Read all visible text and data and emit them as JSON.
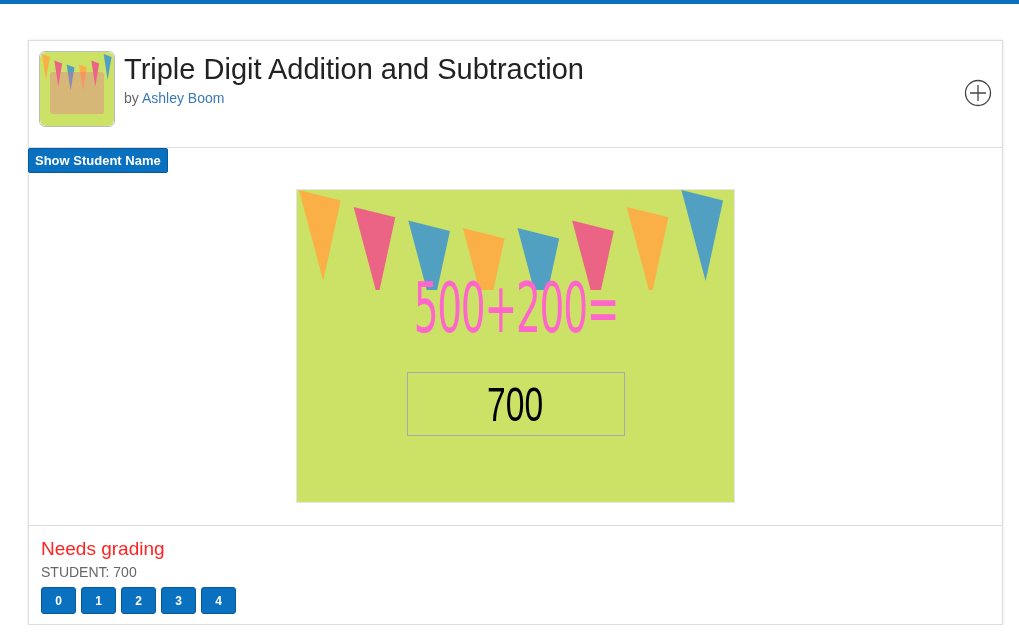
{
  "deck": {
    "title": "Triple Digit Addition and Subtraction",
    "by_prefix": "by",
    "author": "Ashley Boom"
  },
  "show_name_button": "Show Student Name",
  "slide": {
    "question": "500+200=",
    "answer": "700"
  },
  "grading": {
    "status": "Needs grading",
    "student_answer": "STUDENT: 700",
    "scores": [
      {
        "label": "0"
      },
      {
        "label": "1"
      },
      {
        "label": "2"
      },
      {
        "label": "3"
      },
      {
        "label": "4"
      }
    ]
  }
}
